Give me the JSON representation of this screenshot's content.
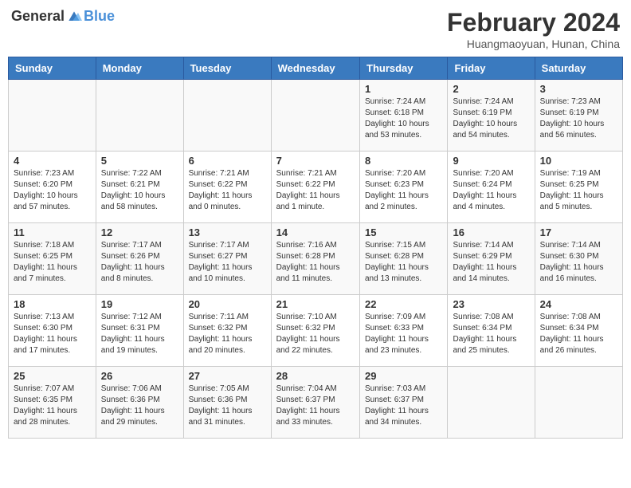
{
  "header": {
    "logo_general": "General",
    "logo_blue": "Blue",
    "month_year": "February 2024",
    "location": "Huangmaoyuan, Hunan, China"
  },
  "weekdays": [
    "Sunday",
    "Monday",
    "Tuesday",
    "Wednesday",
    "Thursday",
    "Friday",
    "Saturday"
  ],
  "weeks": [
    [
      {
        "day": "",
        "info": ""
      },
      {
        "day": "",
        "info": ""
      },
      {
        "day": "",
        "info": ""
      },
      {
        "day": "",
        "info": ""
      },
      {
        "day": "1",
        "info": "Sunrise: 7:24 AM\nSunset: 6:18 PM\nDaylight: 10 hours and 53 minutes."
      },
      {
        "day": "2",
        "info": "Sunrise: 7:24 AM\nSunset: 6:19 PM\nDaylight: 10 hours and 54 minutes."
      },
      {
        "day": "3",
        "info": "Sunrise: 7:23 AM\nSunset: 6:19 PM\nDaylight: 10 hours and 56 minutes."
      }
    ],
    [
      {
        "day": "4",
        "info": "Sunrise: 7:23 AM\nSunset: 6:20 PM\nDaylight: 10 hours and 57 minutes."
      },
      {
        "day": "5",
        "info": "Sunrise: 7:22 AM\nSunset: 6:21 PM\nDaylight: 10 hours and 58 minutes."
      },
      {
        "day": "6",
        "info": "Sunrise: 7:21 AM\nSunset: 6:22 PM\nDaylight: 11 hours and 0 minutes."
      },
      {
        "day": "7",
        "info": "Sunrise: 7:21 AM\nSunset: 6:22 PM\nDaylight: 11 hours and 1 minute."
      },
      {
        "day": "8",
        "info": "Sunrise: 7:20 AM\nSunset: 6:23 PM\nDaylight: 11 hours and 2 minutes."
      },
      {
        "day": "9",
        "info": "Sunrise: 7:20 AM\nSunset: 6:24 PM\nDaylight: 11 hours and 4 minutes."
      },
      {
        "day": "10",
        "info": "Sunrise: 7:19 AM\nSunset: 6:25 PM\nDaylight: 11 hours and 5 minutes."
      }
    ],
    [
      {
        "day": "11",
        "info": "Sunrise: 7:18 AM\nSunset: 6:25 PM\nDaylight: 11 hours and 7 minutes."
      },
      {
        "day": "12",
        "info": "Sunrise: 7:17 AM\nSunset: 6:26 PM\nDaylight: 11 hours and 8 minutes."
      },
      {
        "day": "13",
        "info": "Sunrise: 7:17 AM\nSunset: 6:27 PM\nDaylight: 11 hours and 10 minutes."
      },
      {
        "day": "14",
        "info": "Sunrise: 7:16 AM\nSunset: 6:28 PM\nDaylight: 11 hours and 11 minutes."
      },
      {
        "day": "15",
        "info": "Sunrise: 7:15 AM\nSunset: 6:28 PM\nDaylight: 11 hours and 13 minutes."
      },
      {
        "day": "16",
        "info": "Sunrise: 7:14 AM\nSunset: 6:29 PM\nDaylight: 11 hours and 14 minutes."
      },
      {
        "day": "17",
        "info": "Sunrise: 7:14 AM\nSunset: 6:30 PM\nDaylight: 11 hours and 16 minutes."
      }
    ],
    [
      {
        "day": "18",
        "info": "Sunrise: 7:13 AM\nSunset: 6:30 PM\nDaylight: 11 hours and 17 minutes."
      },
      {
        "day": "19",
        "info": "Sunrise: 7:12 AM\nSunset: 6:31 PM\nDaylight: 11 hours and 19 minutes."
      },
      {
        "day": "20",
        "info": "Sunrise: 7:11 AM\nSunset: 6:32 PM\nDaylight: 11 hours and 20 minutes."
      },
      {
        "day": "21",
        "info": "Sunrise: 7:10 AM\nSunset: 6:32 PM\nDaylight: 11 hours and 22 minutes."
      },
      {
        "day": "22",
        "info": "Sunrise: 7:09 AM\nSunset: 6:33 PM\nDaylight: 11 hours and 23 minutes."
      },
      {
        "day": "23",
        "info": "Sunrise: 7:08 AM\nSunset: 6:34 PM\nDaylight: 11 hours and 25 minutes."
      },
      {
        "day": "24",
        "info": "Sunrise: 7:08 AM\nSunset: 6:34 PM\nDaylight: 11 hours and 26 minutes."
      }
    ],
    [
      {
        "day": "25",
        "info": "Sunrise: 7:07 AM\nSunset: 6:35 PM\nDaylight: 11 hours and 28 minutes."
      },
      {
        "day": "26",
        "info": "Sunrise: 7:06 AM\nSunset: 6:36 PM\nDaylight: 11 hours and 29 minutes."
      },
      {
        "day": "27",
        "info": "Sunrise: 7:05 AM\nSunset: 6:36 PM\nDaylight: 11 hours and 31 minutes."
      },
      {
        "day": "28",
        "info": "Sunrise: 7:04 AM\nSunset: 6:37 PM\nDaylight: 11 hours and 33 minutes."
      },
      {
        "day": "29",
        "info": "Sunrise: 7:03 AM\nSunset: 6:37 PM\nDaylight: 11 hours and 34 minutes."
      },
      {
        "day": "",
        "info": ""
      },
      {
        "day": "",
        "info": ""
      }
    ]
  ]
}
